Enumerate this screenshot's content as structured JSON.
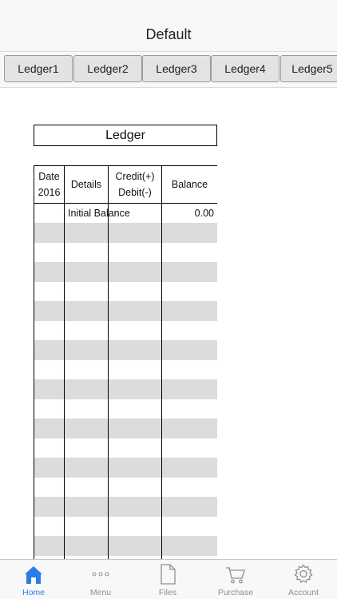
{
  "header": {
    "title": "Default"
  },
  "tabs": [
    {
      "label": "Ledger1"
    },
    {
      "label": "Ledger2"
    },
    {
      "label": "Ledger3"
    },
    {
      "label": "Ledger4"
    },
    {
      "label": "Ledger5"
    }
  ],
  "ledger": {
    "title": "Ledger",
    "columns": {
      "date_line1": "Date",
      "date_line2": "2016",
      "details": "Details",
      "credit_line1": "Credit(+)",
      "credit_line2": "Debit(-)",
      "balance": "Balance"
    },
    "rows": [
      {
        "date": "",
        "details": "Initial Balance",
        "amount": "",
        "balance": "0.00"
      }
    ]
  },
  "tabbar": {
    "items": [
      {
        "label": "Home",
        "icon": "home-icon",
        "active": true
      },
      {
        "label": "Menu",
        "icon": "more-dots-icon"
      },
      {
        "label": "Files",
        "icon": "file-icon"
      },
      {
        "label": "Purchase",
        "icon": "cart-icon"
      },
      {
        "label": "Account",
        "icon": "gear-icon"
      }
    ]
  },
  "colors": {
    "accent": "#2a7ce6",
    "stripe": "#dcdcdc"
  }
}
